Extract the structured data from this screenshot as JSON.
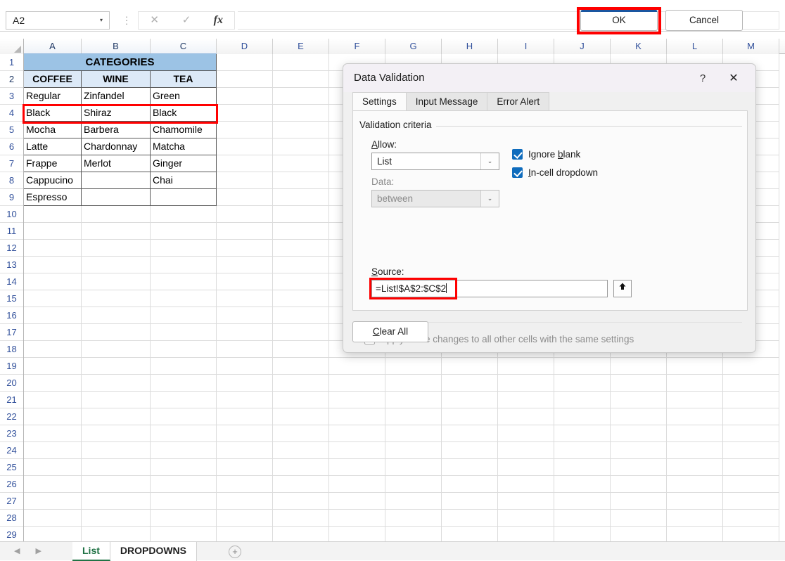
{
  "formula_bar": {
    "name_box_value": "A2",
    "name_box_arrow": "▾",
    "cancel_icon": "✕",
    "enter_icon": "✓",
    "function_icon": "fx",
    "formula_value": ""
  },
  "grid": {
    "columns": [
      "A",
      "B",
      "C",
      "D",
      "E",
      "F",
      "G",
      "H",
      "I",
      "J",
      "K",
      "L",
      "M"
    ],
    "selected_columns": [
      "A",
      "B",
      "C"
    ],
    "rows": [
      1,
      2,
      3,
      4,
      5,
      6,
      7,
      8,
      9,
      10,
      11,
      12,
      13,
      14,
      15,
      16,
      17,
      18,
      19,
      20,
      21,
      22,
      23,
      24,
      25,
      26,
      27,
      28,
      29
    ],
    "selected_rows": [
      2
    ],
    "merged_title": "CATEGORIES",
    "headers": [
      "COFFEE",
      "WINE",
      "TEA"
    ],
    "data": [
      [
        "Regular",
        "Zinfandel",
        "Green"
      ],
      [
        "Black",
        "Shiraz",
        "Black"
      ],
      [
        "Mocha",
        "Barbera",
        "Chamomile"
      ],
      [
        "Latte",
        "Chardonnay",
        "Matcha"
      ],
      [
        "Frappe",
        "Merlot",
        "Ginger"
      ],
      [
        "Cappucino",
        "",
        "Chai"
      ],
      [
        "Espresso",
        "",
        ""
      ]
    ]
  },
  "tab_bar": {
    "prev_icon": "◀",
    "next_icon": "▶",
    "sheets": [
      {
        "label": "List",
        "active": true
      },
      {
        "label": "DROPDOWNS",
        "active": false
      }
    ],
    "add_sheet_icon": "+"
  },
  "dialog": {
    "title": "Data Validation",
    "help_icon": "?",
    "close_icon": "✕",
    "tabs": [
      {
        "label": "Settings",
        "active": true
      },
      {
        "label": "Input Message",
        "active": false
      },
      {
        "label": "Error Alert",
        "active": false
      }
    ],
    "criteria_legend": "Validation criteria",
    "allow_label": "Allow:",
    "allow_value": "List",
    "allow_arrow": "⌄",
    "data_label": "Data:",
    "data_value": "between",
    "data_arrow": "⌄",
    "source_label": "Source:",
    "source_value": "=List!$A$2:$C$2",
    "range_picker_icon": "⬆",
    "ignore_blank_label": "Ignore blank",
    "in_cell_dropdown_label": "In-cell dropdown",
    "apply_changes_label": "Apply these changes to all other cells with the same settings",
    "clear_all_label": "Clear All",
    "ok_label": "OK",
    "cancel_label": "Cancel"
  },
  "colors": {
    "highlight_red": "#ff0000",
    "accent_blue": "#0f6cbd",
    "header_row1_fill": "#9cc3e5",
    "header_row2_fill": "#dce9f7",
    "sheet_active_green": "#217346"
  }
}
